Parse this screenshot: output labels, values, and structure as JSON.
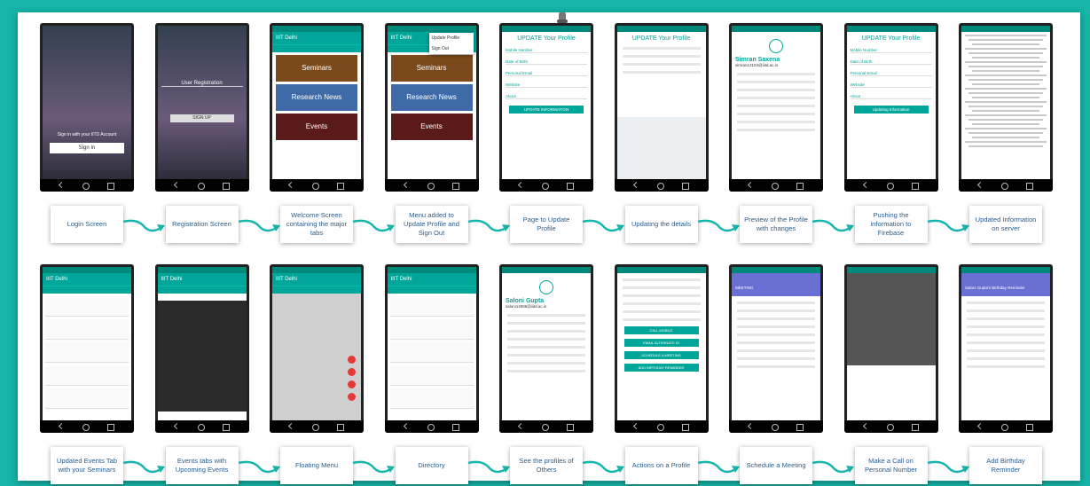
{
  "colors": {
    "background": "#16b5a8",
    "label_text": "#2c5d8a",
    "arrow": "#17b5ad",
    "app_teal": "#00a699"
  },
  "row1": {
    "screens": [
      {
        "label": "Login Screen",
        "title": "",
        "variant": "login",
        "login_text": "Sign in with your IITD Account",
        "signin": "Sign In"
      },
      {
        "label": "Registration Screen",
        "variant": "register",
        "title": "User Registration",
        "signup": "SIGN UP"
      },
      {
        "label": "Welcome Screen containing the major tabs",
        "variant": "tabs",
        "title": "IIIT Delhi",
        "cards": [
          "Seminars",
          "Research News",
          "Events"
        ]
      },
      {
        "label": "Menu added to Update Profile and Sign Out",
        "variant": "menu",
        "title": "IIIT Delhi",
        "menu": [
          "Update Profile",
          "Sign Out"
        ],
        "cards": [
          "Seminars",
          "Research News",
          "Events"
        ]
      },
      {
        "label": "Page to Update Profile",
        "variant": "form",
        "title": "UPDATE Your Profile",
        "fields": [
          "Mobile Number",
          "Date of Birth",
          "Personal Email",
          "Website",
          "About"
        ],
        "button": "UPDATE INFORMATION"
      },
      {
        "label": "Updating the details",
        "variant": "keyboard",
        "title": "UPDATE Your Profile"
      },
      {
        "label": "Preview of the Profile with changes",
        "variant": "profile",
        "title": "Simran Saxena",
        "subtitle": "simran13104@iiitd.ac.in"
      },
      {
        "label": "Pushing the information to Firebase",
        "variant": "form",
        "title": "UPDATE Your Profile",
        "fields": [
          "Mobile Number",
          "Date of Birth",
          "Personal Email",
          "Website",
          "About"
        ],
        "button": "Updating Information"
      },
      {
        "label": "Updated Information on server",
        "variant": "json"
      }
    ]
  },
  "row2": {
    "screens": [
      {
        "label": "Updated Events Tab with your Seminars",
        "variant": "list",
        "title": "IIIT Delhi"
      },
      {
        "label": "Events tabs with Upcoming Events",
        "variant": "dark",
        "title": "IIIT Delhi"
      },
      {
        "label": "Floating Menu",
        "variant": "fab",
        "title": "IIIT Delhi"
      },
      {
        "label": "Directory",
        "variant": "directory",
        "title": "IIIT Delhi"
      },
      {
        "label": "See the profiles of Others",
        "variant": "profile",
        "title": "Saloni Gupta",
        "subtitle": "saloni14086@iiitd.ac.in"
      },
      {
        "label": "Actions on a Profile",
        "variant": "actions",
        "title": "",
        "actions": [
          "CALL MOBILE",
          "EMAIL ALTERNATE ID",
          "SCHEDULE A MEETING",
          "ADD BIRTHDAY REMINDER"
        ]
      },
      {
        "label": "Schedule a Meeting",
        "variant": "calendar",
        "title": "MEETING"
      },
      {
        "label": "Make a Call on Personal Number",
        "variant": "call",
        "title": ""
      },
      {
        "label": "Add Birthday Reminder",
        "variant": "calendar",
        "title": "Saloni Gupta's Birthday Reminder"
      }
    ]
  }
}
